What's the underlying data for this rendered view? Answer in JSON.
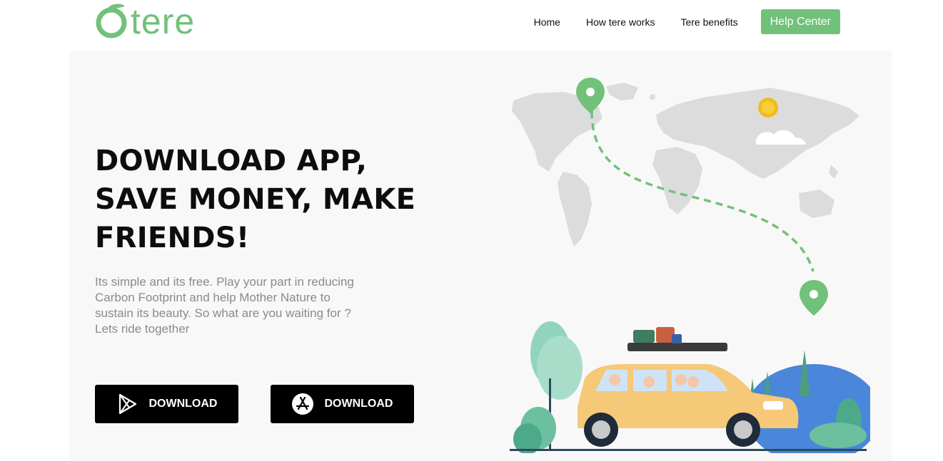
{
  "header": {
    "logo_text": "tere",
    "nav": {
      "home": "Home",
      "how": "How tere works",
      "benefits": "Tere benefits",
      "help": "Help Center"
    }
  },
  "hero": {
    "headline_lines": [
      "DOWNLOAD APP,",
      "SAVE MONEY, MAKE",
      "FRIENDS!"
    ],
    "subtitle_lines": [
      "Its simple and its free. Play your part in reducing",
      "Carbon Footprint and help Mother Nature to",
      "sustain its beauty. So what are you waiting for ?",
      "Lets ride together"
    ],
    "download_play_label": "DOWNLOAD",
    "download_apple_label": "DOWNLOAD"
  },
  "icons": {
    "logo_mark": "circle-leaf-icon",
    "play": "play-store-icon",
    "apple": "app-store-icon"
  },
  "colors": {
    "brand_green": "#72c17a",
    "button_black": "#000000",
    "hero_bg": "#f8f8f8",
    "car_yellow": "#f5c978"
  }
}
